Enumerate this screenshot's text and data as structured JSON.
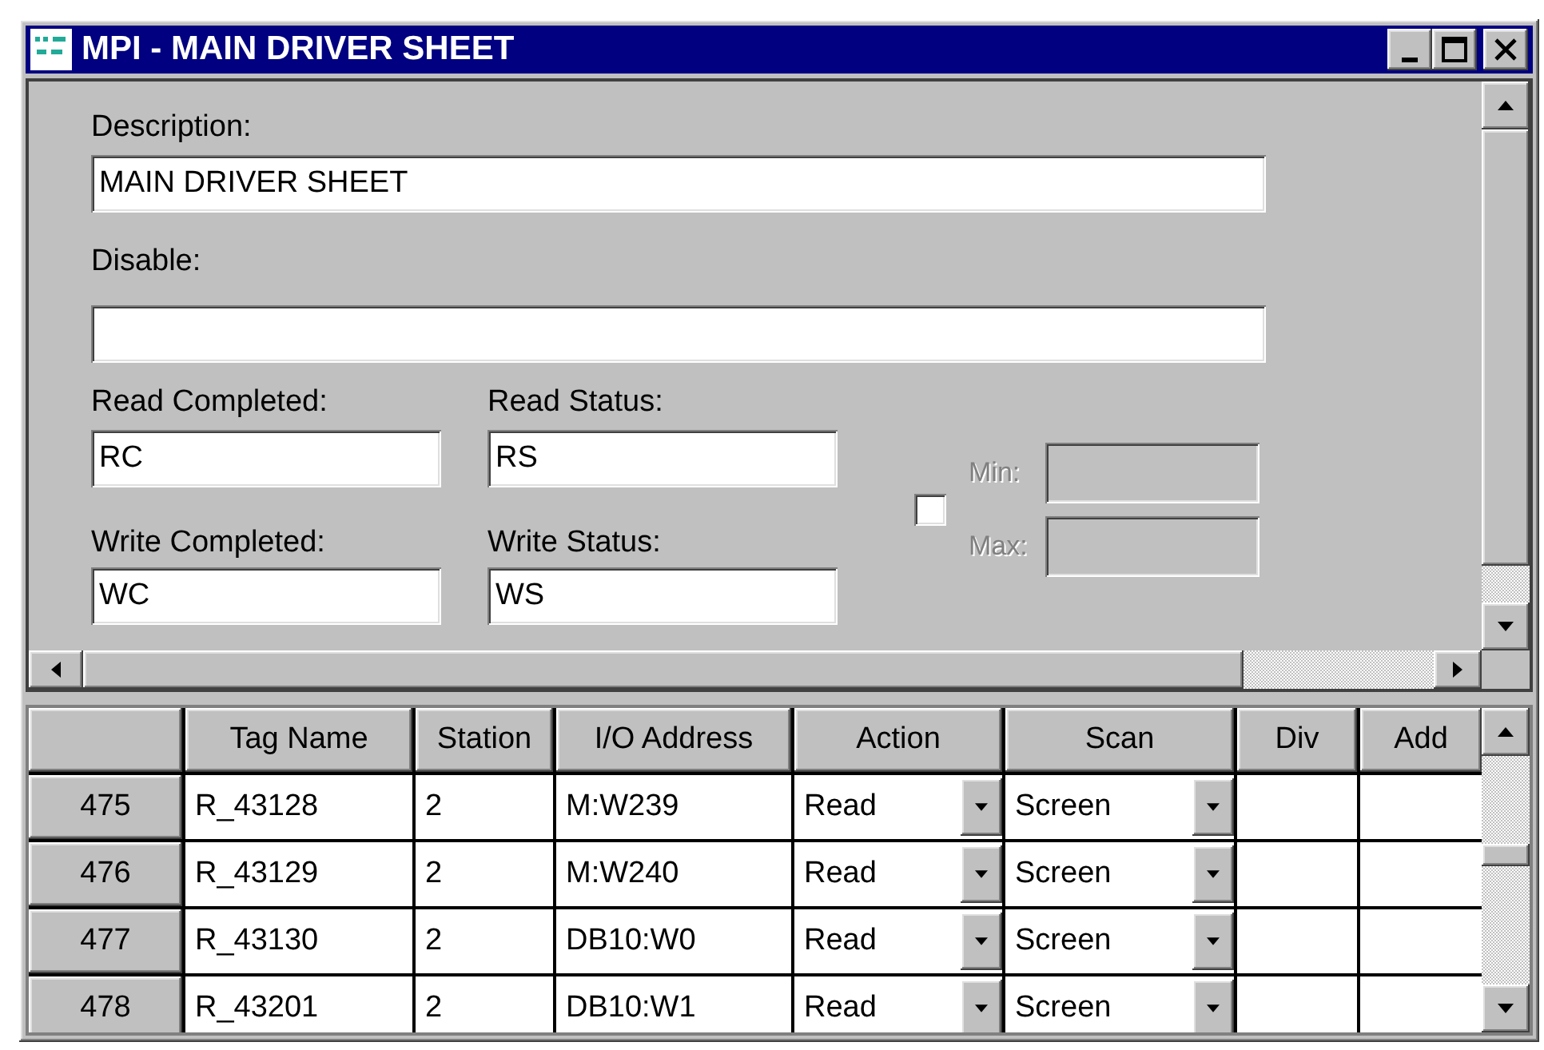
{
  "window": {
    "title": "MPI - MAIN DRIVER SHEET"
  },
  "form": {
    "description": {
      "label": "Description:",
      "value": "MAIN DRIVER SHEET"
    },
    "disable": {
      "label": "Disable:"
    },
    "read_completed": {
      "label": "Read Completed:",
      "value": "RC"
    },
    "read_status": {
      "label": "Read Status:",
      "value": "RS"
    },
    "write_completed": {
      "label": "Write Completed:",
      "value": "WC"
    },
    "write_status": {
      "label": "Write Status:",
      "value": "WS"
    },
    "range": {
      "checked": false,
      "disabled": true,
      "min_label": "Min:",
      "max_label": "Max:"
    }
  },
  "table": {
    "columns": [
      "Tag Name",
      "Station",
      "I/O Address",
      "Action",
      "Scan",
      "Div",
      "Add"
    ],
    "rows": [
      {
        "number": "475",
        "tag_name": "R_43128",
        "station": "2",
        "io_address": "M:W239",
        "action": "Read",
        "scan": "Screen"
      },
      {
        "number": "476",
        "tag_name": "R_43129",
        "station": "2",
        "io_address": "M:W240",
        "action": "Read",
        "scan": "Screen"
      },
      {
        "number": "477",
        "tag_name": "R_43130",
        "station": "2",
        "io_address": "DB10:W0",
        "action": "Read",
        "scan": "Screen"
      },
      {
        "number": "478",
        "tag_name": "R_43201",
        "station": "2",
        "io_address": "DB10:W1",
        "action": "Read",
        "scan": "Screen"
      }
    ]
  }
}
